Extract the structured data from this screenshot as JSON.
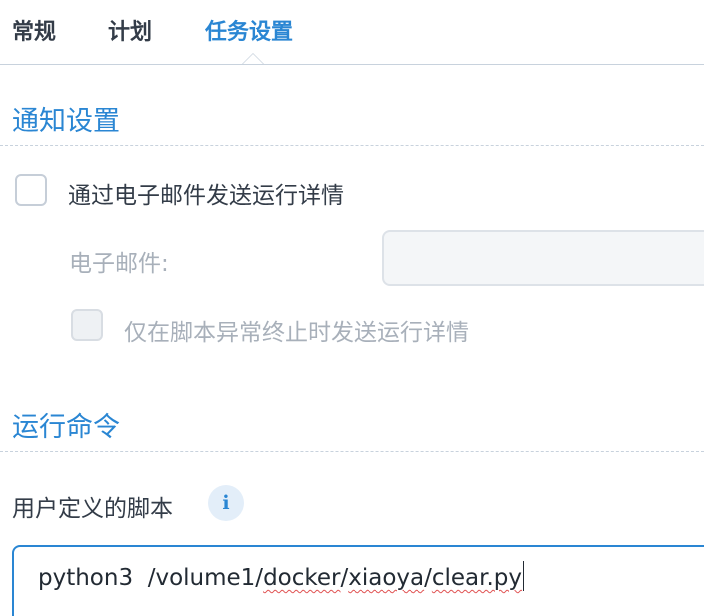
{
  "tabs": [
    {
      "label": "常规",
      "active": false
    },
    {
      "label": "计划",
      "active": false
    },
    {
      "label": "任务设置",
      "active": true
    }
  ],
  "notify": {
    "title": "通知设置",
    "email_option_label": "通过电子邮件发送运行详情",
    "email_option_checked": false,
    "email_field_label": "电子邮件:",
    "email_value": "",
    "abnormal_label": "仅在脚本异常终止时发送运行详情",
    "abnormal_checked": false
  },
  "command": {
    "title": "运行命令",
    "script_label": "用户定义的脚本",
    "info_icon": "info-icon",
    "script_prefix": "python3  ",
    "script_path_a": "/volume1/",
    "script_path_b": "docker",
    "script_path_c": "/",
    "script_path_d": "xiaoya",
    "script_path_e": "/",
    "script_path_f": "clear.py"
  },
  "colors": {
    "accent": "#2a86d3",
    "text": "#333c48",
    "disabled_text": "#a8b0ba"
  }
}
